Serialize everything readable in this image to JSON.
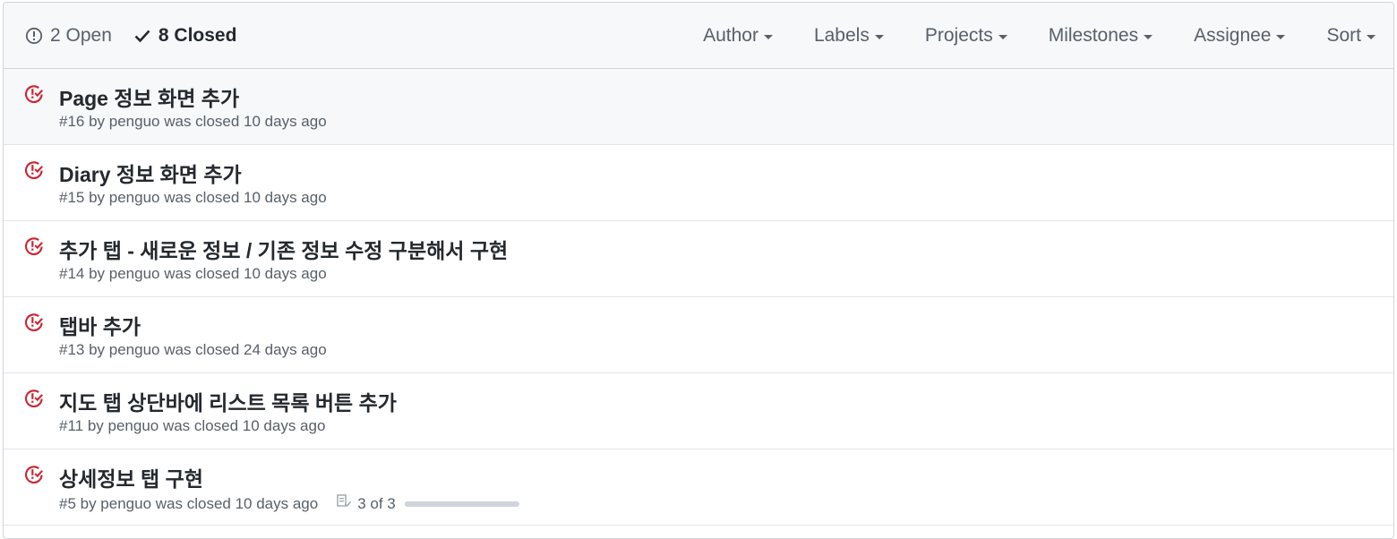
{
  "header": {
    "open_label": "2 Open",
    "closed_label": "8 Closed",
    "filters": [
      {
        "label": "Author"
      },
      {
        "label": "Labels"
      },
      {
        "label": "Projects"
      },
      {
        "label": "Milestones"
      },
      {
        "label": "Assignee"
      },
      {
        "label": "Sort"
      }
    ]
  },
  "colors": {
    "closed_icon": "#cb2431",
    "muted_text": "#586069",
    "title_text": "#24292e"
  },
  "issues": [
    {
      "title": "Page 정보 화면 추가",
      "meta": "#16 by penguo was closed 10 days ago",
      "icon": "issue-closed-icon"
    },
    {
      "title": "Diary 정보 화면 추가",
      "meta": "#15 by penguo was closed 10 days ago",
      "icon": "issue-closed-icon"
    },
    {
      "title": "추가 탭 - 새로운 정보 / 기존 정보 수정 구분해서 구현",
      "meta": "#14 by penguo was closed 10 days ago",
      "icon": "issue-closed-icon"
    },
    {
      "title": "탭바 추가",
      "meta": "#13 by penguo was closed 24 days ago",
      "icon": "issue-closed-icon"
    },
    {
      "title": "지도 탭 상단바에 리스트 목록 버튼 추가",
      "meta": "#11 by penguo was closed 10 days ago",
      "icon": "issue-closed-icon"
    },
    {
      "title": "상세정보 탭 구현",
      "meta": "#5 by penguo was closed 10 days ago",
      "icon": "issue-closed-icon",
      "tasks": "3 of 3",
      "progress": 1.0
    }
  ]
}
